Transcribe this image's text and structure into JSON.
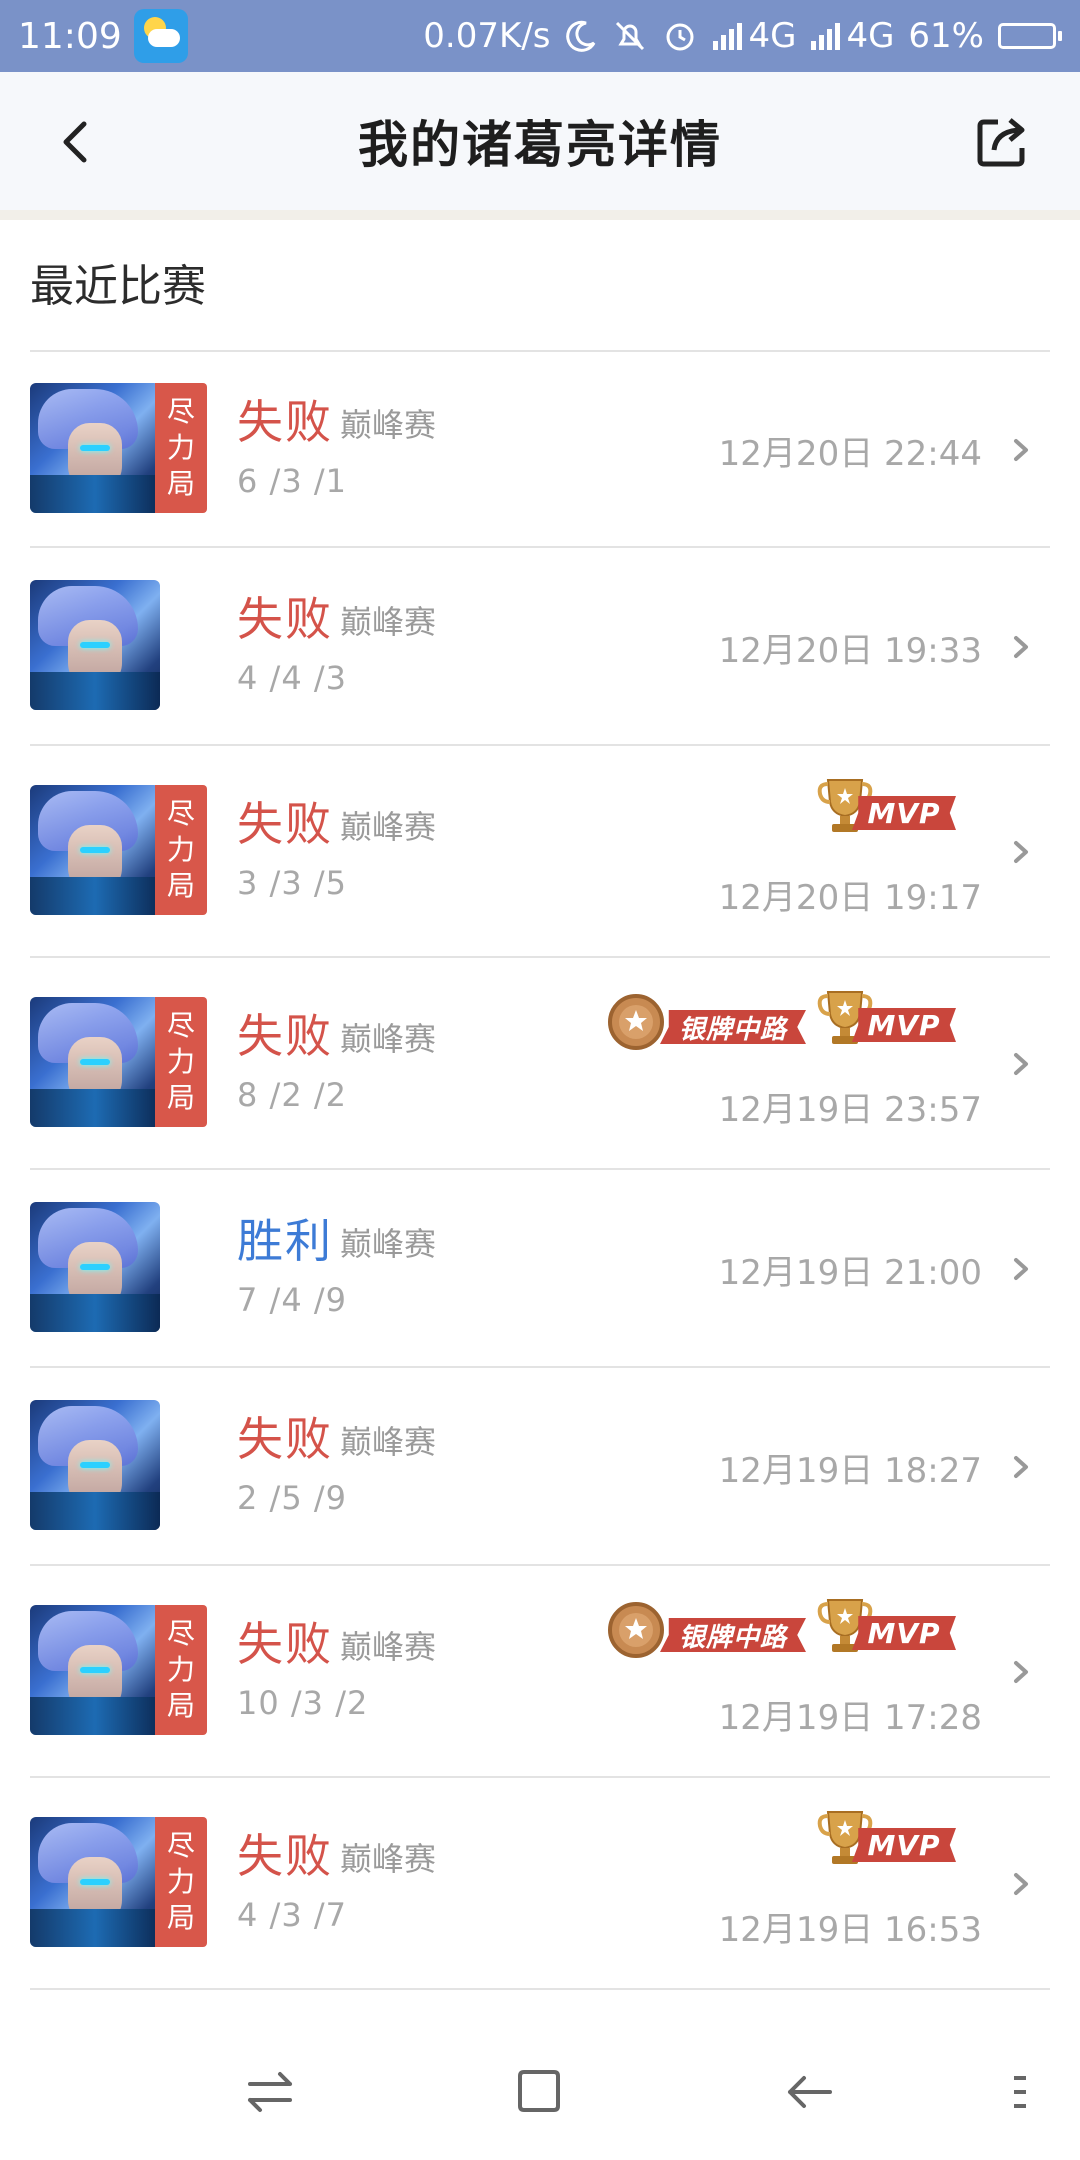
{
  "status_bar": {
    "time": "11:09",
    "network_speed": "0.07K/s",
    "signal_1": "4G",
    "signal_2": "4G",
    "battery_text": "61%",
    "battery_level": 0.61,
    "icons": [
      "weather-icon",
      "moon-icon",
      "mute-bell-icon",
      "alarm-icon",
      "signal-icon",
      "signal-icon",
      "battery-icon"
    ]
  },
  "header": {
    "title": "我的诸葛亮详情",
    "back_icon": "back-arrow-icon",
    "share_icon": "share-icon"
  },
  "section": {
    "title": "最近比赛"
  },
  "colors": {
    "lose": "#d4534a",
    "win": "#3d7bd6",
    "tag": "#d8574a",
    "status_bar": "#7a92c8"
  },
  "matches": [
    {
      "result": "失败",
      "outcome": "lose",
      "mode": "巅峰赛",
      "kda": "6 /3 /1",
      "time": "12月20日 22:44",
      "tag": "尽\n力\n局",
      "badges": []
    },
    {
      "result": "失败",
      "outcome": "lose",
      "mode": "巅峰赛",
      "kda": "4 /4 /3",
      "time": "12月20日 19:33",
      "tag": "",
      "badges": []
    },
    {
      "result": "失败",
      "outcome": "lose",
      "mode": "巅峰赛",
      "kda": "3 /3 /5",
      "time": "12月20日 19:17",
      "tag": "尽\n力\n局",
      "badges": [
        "MVP"
      ]
    },
    {
      "result": "失败",
      "outcome": "lose",
      "mode": "巅峰赛",
      "kda": "8 /2 /2",
      "time": "12月19日 23:57",
      "tag": "尽\n力\n局",
      "badges": [
        "银牌中路",
        "MVP"
      ]
    },
    {
      "result": "胜利",
      "outcome": "win",
      "mode": "巅峰赛",
      "kda": "7 /4 /9",
      "time": "12月19日 21:00",
      "tag": "",
      "badges": []
    },
    {
      "result": "失败",
      "outcome": "lose",
      "mode": "巅峰赛",
      "kda": "2 /5 /9",
      "time": "12月19日 18:27",
      "tag": "",
      "badges": []
    },
    {
      "result": "失败",
      "outcome": "lose",
      "mode": "巅峰赛",
      "kda": "10 /3 /2",
      "time": "12月19日 17:28",
      "tag": "尽\n力\n局",
      "badges": [
        "银牌中路",
        "MVP"
      ]
    },
    {
      "result": "失败",
      "outcome": "lose",
      "mode": "巅峰赛",
      "kda": "4 /3 /7",
      "time": "12月19日 16:53",
      "tag": "尽\n力\n局",
      "badges": [
        "MVP"
      ]
    }
  ],
  "bottom_nav": {
    "icons": [
      "switch-icon",
      "home-square-icon",
      "nav-back-icon",
      "menu-icon"
    ]
  }
}
